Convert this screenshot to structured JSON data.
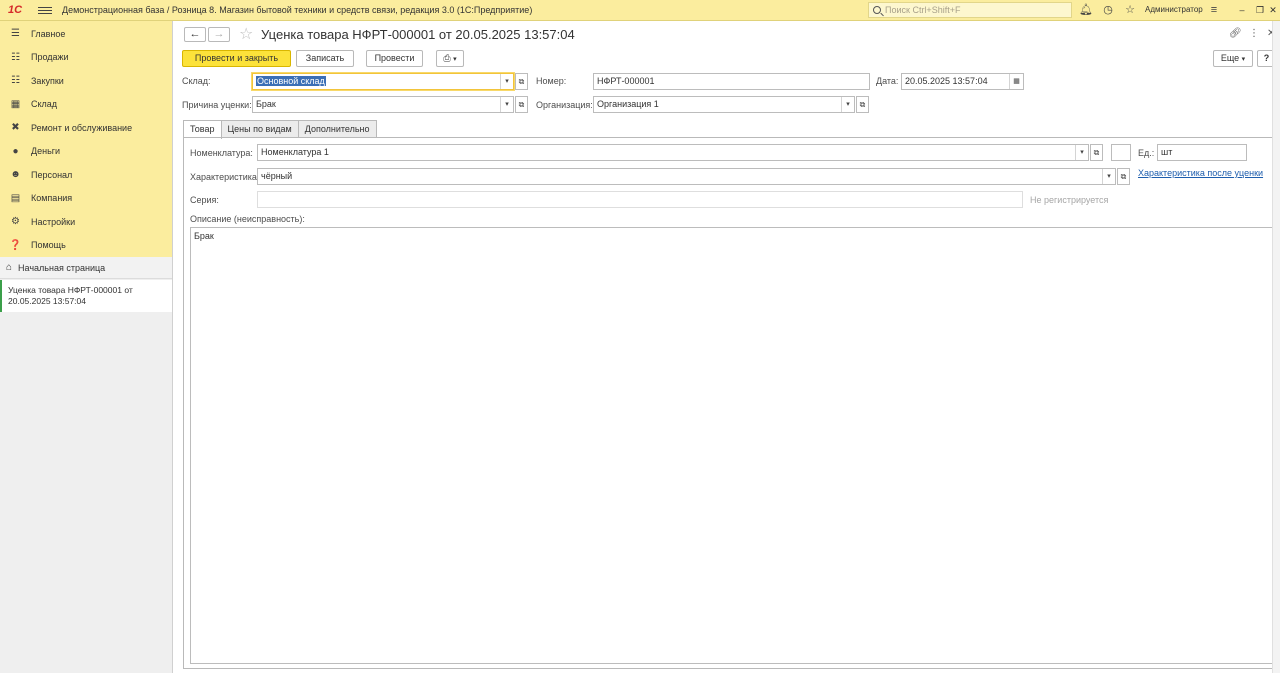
{
  "app": {
    "logo": "1С",
    "title": "Демонстрационная база / Розница 8. Магазин бытовой техники и средств связи, редакция 3.0  (1С:Предприятие)",
    "search_placeholder": "Поиск Ctrl+Shift+F",
    "user": "Администратор"
  },
  "sidebar": {
    "items": [
      {
        "label": "Главное",
        "icon": "menu-icon"
      },
      {
        "label": "Продажи",
        "icon": "cart-icon"
      },
      {
        "label": "Закупки",
        "icon": "basket-icon"
      },
      {
        "label": "Склад",
        "icon": "warehouse-icon"
      },
      {
        "label": "Ремонт и обслуживание",
        "icon": "tools-icon"
      },
      {
        "label": "Деньги",
        "icon": "money-icon"
      },
      {
        "label": "Персонал",
        "icon": "person-icon"
      },
      {
        "label": "Компания",
        "icon": "company-icon"
      },
      {
        "label": "Настройки",
        "icon": "gear-icon"
      },
      {
        "label": "Помощь",
        "icon": "help-icon"
      }
    ],
    "home": "Начальная страница",
    "open_doc_line1": "Уценка товара НФРТ-000001 от",
    "open_doc_line2": "20.05.2025 13:57:04"
  },
  "document": {
    "title": "Уценка товара НФРТ-000001 от 20.05.2025 13:57:04",
    "toolbar": {
      "post_close": "Провести и закрыть",
      "save": "Записать",
      "post": "Провести",
      "more": "Еще",
      "help": "?"
    },
    "fields": {
      "warehouse_label": "Склад:",
      "warehouse_value": "Основной склад",
      "number_label": "Номер:",
      "number_value": "НФРТ-000001",
      "date_label": "Дата:",
      "date_value": "20.05.2025 13:57:04",
      "reason_label": "Причина уценки:",
      "reason_value": "Брак",
      "org_label": "Организация:",
      "org_value": "Организация 1"
    },
    "tabs": [
      "Товар",
      "Цены по видам",
      "Дополнительно"
    ],
    "product": {
      "nomenclature_label": "Номенклатура:",
      "nomenclature_value": "Номенклатура 1",
      "unit_label": "Ед.:",
      "unit_value": "шт",
      "characteristic_label": "Характеристика:",
      "characteristic_value": "чёрный",
      "characteristic_after_link": "Характеристика после уценки",
      "series_label": "Серия:",
      "series_value": "",
      "series_note": "Не регистрируется",
      "description_label": "Описание (неисправность):",
      "description_value": "Брак"
    }
  }
}
